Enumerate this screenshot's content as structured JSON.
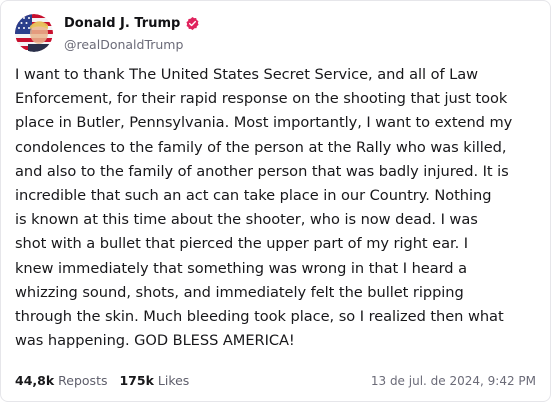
{
  "author": {
    "display_name": "Donald J. Trump",
    "handle": "@realDonaldTrump",
    "verified": true,
    "verified_icon": "verified-badge-icon"
  },
  "post": {
    "lines": [
      "I want to thank The United States Secret Service, and all of Law",
      "Enforcement, for their rapid response on the shooting that just took",
      "place in Butler, Pennsylvania. Most importantly, I want to extend my",
      "condolences to the family of the person at the Rally who was killed,",
      "and also to the family of another person that was badly injured. It is",
      "incredible that such an act can take place in our Country. Nothing",
      "is known at this time about the shooter, who is now dead. I was",
      "shot with a bullet that pierced the upper part of my right ear. I",
      "knew immediately that something was wrong in that I heard a",
      "whizzing sound, shots, and immediately felt the bullet ripping",
      "through the skin. Much bleeding took place, so I realized then what",
      "was happening. GOD BLESS AMERICA!"
    ]
  },
  "stats": {
    "reposts_count": "44,8k",
    "reposts_label": "Reposts",
    "likes_count": "175k",
    "likes_label": "Likes"
  },
  "timestamp": "13 de jul. de 2024, 9:42 PM",
  "colors": {
    "verified": "#e0245e",
    "avatar_blue": "#2b3f8c",
    "avatar_red": "#c8102e"
  }
}
